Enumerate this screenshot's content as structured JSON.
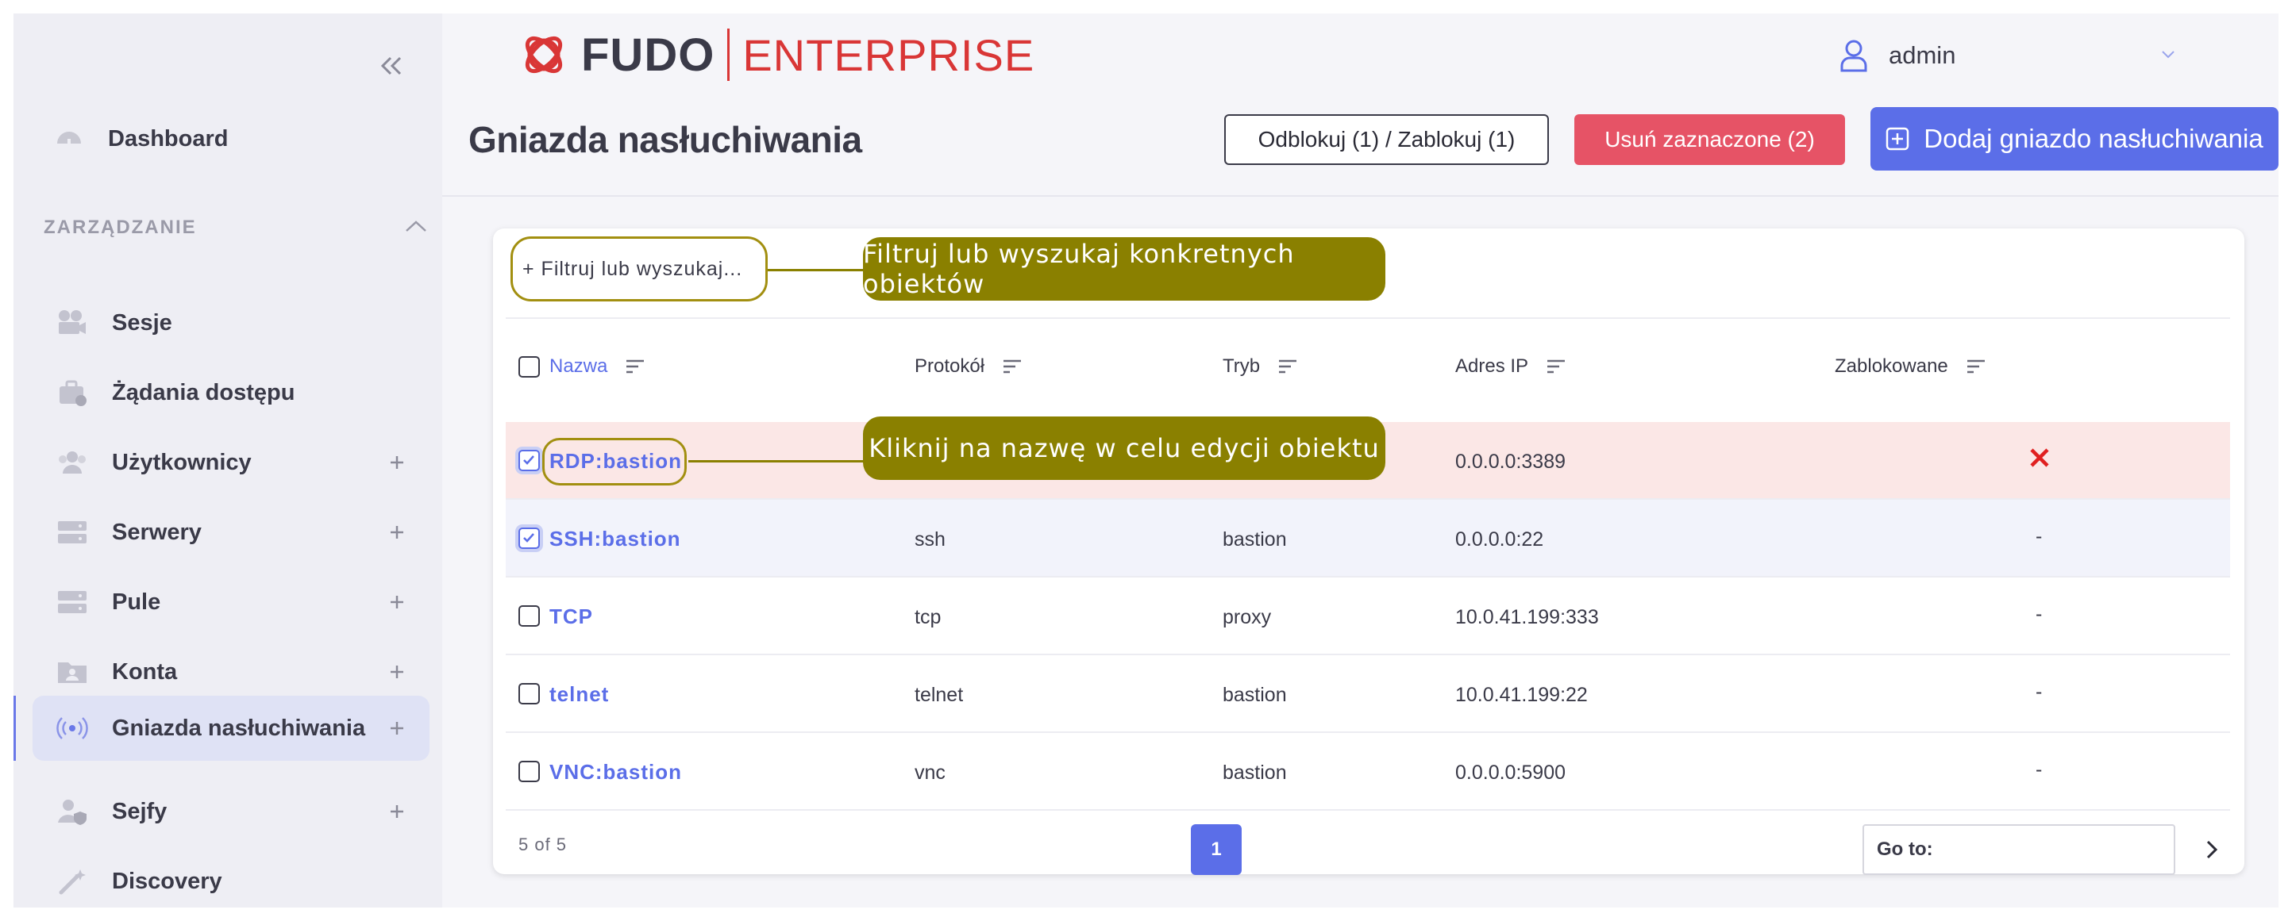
{
  "brand": {
    "name": "FUDO",
    "edition": "ENTERPRISE",
    "colors": {
      "accent": "#5b6ee8",
      "brand_red": "#d93636",
      "danger": "#e65366",
      "tooltip": "#8a8000"
    }
  },
  "sidebar": {
    "dashboard": "Dashboard",
    "section": "ZARZĄDZANIE",
    "items": [
      {
        "label": "Sesje",
        "icon": "camera-icon",
        "expandable": false
      },
      {
        "label": "Żądania dostępu",
        "icon": "briefcase-icon",
        "expandable": false
      },
      {
        "label": "Użytkownicy",
        "icon": "users-icon",
        "expandable": true
      },
      {
        "label": "Serwery",
        "icon": "server-icon",
        "expandable": true
      },
      {
        "label": "Pule",
        "icon": "pool-icon",
        "expandable": true
      },
      {
        "label": "Konta",
        "icon": "folder-account-icon",
        "expandable": true
      },
      {
        "label": "Gniazda nasłuchiwania",
        "icon": "broadcast-icon",
        "expandable": true,
        "active": true
      },
      {
        "label": "Sejfy",
        "icon": "safe-user-icon",
        "expandable": true
      },
      {
        "label": "Discovery",
        "icon": "wand-icon",
        "expandable": false
      }
    ]
  },
  "header": {
    "user": "admin",
    "title": "Gniazda nasłuchiwania",
    "buttons": {
      "toggle_block": "Odblokuj (1) / Zablokuj (1)",
      "delete_selected": "Usuń zaznaczone (2)",
      "add": "Dodaj gniazdo nasłuchiwania"
    }
  },
  "filter": {
    "placeholder": "+ Filtruj lub wyszukaj..."
  },
  "tooltips": {
    "filter": "Filtruj lub wyszukaj konkretnych obiektów",
    "edit": "Kliknij na nazwę w celu edycji obiektu"
  },
  "table": {
    "columns": [
      "Nazwa",
      "Protokół",
      "Tryb",
      "Adres IP",
      "Zablokowane"
    ],
    "rows": [
      {
        "name": "RDP:bastion",
        "protocol": "",
        "mode": "",
        "ip": "0.0.0.0:3389",
        "blocked": "x",
        "checked": true,
        "state": "blocked"
      },
      {
        "name": "SSH:bastion",
        "protocol": "ssh",
        "mode": "bastion",
        "ip": "0.0.0.0:22",
        "blocked": "-",
        "checked": true,
        "state": "selected"
      },
      {
        "name": "TCP",
        "protocol": "tcp",
        "mode": "proxy",
        "ip": "10.0.41.199:333",
        "blocked": "-",
        "checked": false,
        "state": "normal"
      },
      {
        "name": "telnet",
        "protocol": "telnet",
        "mode": "bastion",
        "ip": "10.0.41.199:22",
        "blocked": "-",
        "checked": false,
        "state": "normal"
      },
      {
        "name": "VNC:bastion",
        "protocol": "vnc",
        "mode": "bastion",
        "ip": "0.0.0.0:5900",
        "blocked": "-",
        "checked": false,
        "state": "normal"
      }
    ]
  },
  "pagination": {
    "count_text": "5 of 5",
    "current_page": "1",
    "goto_label": "Go to:"
  }
}
